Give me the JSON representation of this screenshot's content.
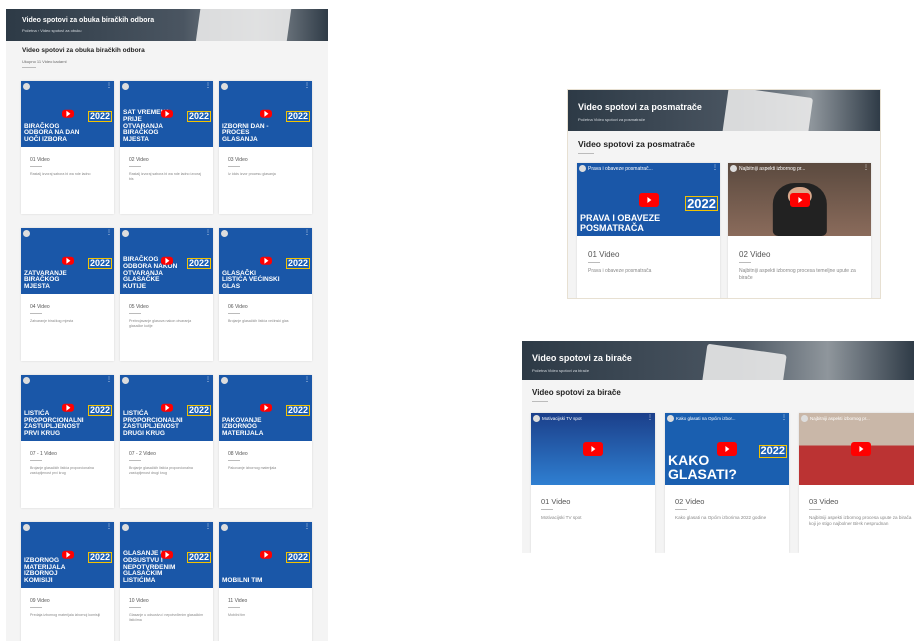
{
  "left_panel": {
    "banner_title": "Video spotovi za obuka biračkih odbora",
    "banner_crumbs": "Početna › Video spotovi za obuku",
    "section_title": "Video spotovi za obuka biračkih odbora",
    "sub_label": "Ukupno 11 Video kadarnl",
    "cards": [
      {
        "thumb": "BIRAČKOG ODBORA NA DAN UOČI IZBORA",
        "video": "01 Video",
        "desc": "Rastalj izvoraj sabora bi wa nde ladno"
      },
      {
        "thumb": "SAT VREMENA PRIJE OTVARANJA BIRAČKOG MJESTA",
        "video": "02 Video",
        "desc": "Rastalj izvoraj sabora bi wa nde ladno izvoraj bis"
      },
      {
        "thumb": "IZBORNI DAN - PROCES GLASANJA",
        "video": "03 Video",
        "desc": "Iz idcis izvor procesu glasanja"
      },
      {
        "thumb": "ZATVARANJE BIRAČKOG MJESTA",
        "video": "04 Video",
        "desc": "Zatvaranje biračkog mjesta"
      },
      {
        "thumb": "BIRAČKOG ODBORA NAKON OTVARANJA GLASAČKE KUTIJE",
        "video": "05 Video",
        "desc": "Prebrojavanje glasova nakon otvaranja glasačke kutije"
      },
      {
        "thumb": "GLASAČKI LISTIĆA VEĆINSKI GLAS",
        "video": "06 Video",
        "desc": "Brojanje glasačkih listića večinski glas"
      },
      {
        "thumb": "LISTIĆA PROPORCIONALNI ZASTUPLJENOST PRVI KRUG",
        "video": "07 - 1 Video",
        "desc": "Brojanje glasačkih listića proporcionalna zastupljenost prvi krug"
      },
      {
        "thumb": "LISTIĆA PROPORCIONALNI ZASTUPLJENOST DRUGI KRUG",
        "video": "07 - 2 Video",
        "desc": "Brojanje glasačkih listića proporcionalna zastupljenost drugi krug"
      },
      {
        "thumb": "PAKOVANJE IZBORNOG MATERIJALA",
        "video": "08 Video",
        "desc": "Pakovanje izbornog materijala"
      },
      {
        "thumb": "IZBORNOG MATERIJALA IZBORNOJ KOMISIJI",
        "video": "09 Video",
        "desc": "Predaja izbornog materijala izbornoj komisiji"
      },
      {
        "thumb": "GLASANJE U ODSUSTVU I NEPOTVRĐENIM GLASAČKIM LISTIĆIMA",
        "video": "10 Video",
        "desc": "Glasanje u odsustvu i nepotvrđenim glasačkim listićima"
      },
      {
        "thumb": "MOBILNI TIM",
        "video": "11 Video",
        "desc": "Mobilni tim"
      }
    ]
  },
  "obs_panel": {
    "banner_title": "Video spotovi za posmatrače",
    "banner_crumbs": "Početna   Video spotovi za posmatrače",
    "section_title": "Video spotovi za posmatrače",
    "cards": [
      {
        "chan": "Prava i obaveze posmatrač...",
        "thumb": "PRAVA I OBAVEZE POSMATRAČA",
        "video": "01 Video",
        "desc": "Prava i obaveze posmatrača"
      },
      {
        "chan": "Najbitniji aspekti izbornog pr...",
        "thumb": "",
        "video": "02 Video",
        "desc": "Najbitniji aspekti izbornog procesa temeljne upute za birače"
      }
    ]
  },
  "voters_panel": {
    "banner_title": "Video spotovi za birače",
    "banner_crumbs": "Početna   Video spotovi za birače",
    "section_title": "Video spotovi za birače",
    "cards": [
      {
        "chan": "Motivacijski TV spot",
        "thumb": "",
        "video": "01 Video",
        "desc": "Motivacijski TV spot"
      },
      {
        "chan": "Kako glasati na Općim izbor...",
        "thumb": "KAKO GLASATI?",
        "video": "02 Video",
        "desc": "Kako glasati na Općim izborima 2022 godine"
      },
      {
        "chan": "Najbitniji aspekti izbornog pr...",
        "thumb": "",
        "video": "03 Video",
        "desc": "Najbitniji aspekti izbornog procesa upute za birača koji je stigo najbolner BiHk nesprudnan"
      }
    ]
  },
  "year_badge": "2022",
  "colors": {
    "thumb_blue": "#1a57a8",
    "youtube_red": "#ff0000",
    "badge_yellow": "#f2c200",
    "banner_dark": "#2d3a46"
  }
}
